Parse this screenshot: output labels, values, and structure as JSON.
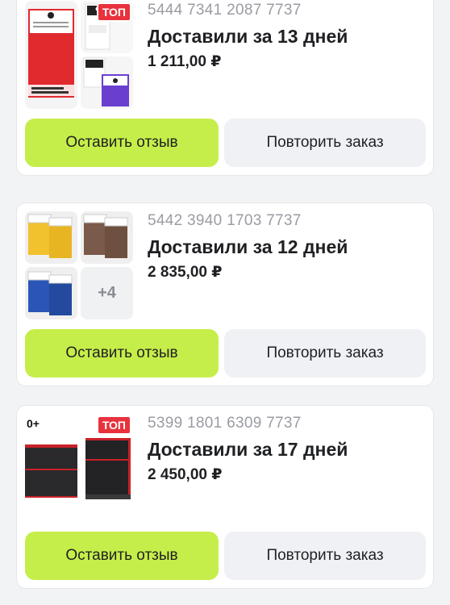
{
  "theme": {
    "accent": "#c6ee4a",
    "secondary_button": "#f0f1f4",
    "badge": "#e8323c",
    "background": "#f2f3f5"
  },
  "orders": [
    {
      "order_number": "5444 7341 2087 7737",
      "status": "Доставили за 13 дней",
      "price": "1 211,00 ₽",
      "badge": "ТОП",
      "thumbnails": [
        "red-card-sleeves",
        "white-card-sleeves",
        "purple-card-sleeves"
      ],
      "review_label": "Оставить отзыв",
      "repeat_label": "Повторить заказ"
    },
    {
      "order_number": "5442 3940 1703 7737",
      "status": "Доставили за 12 дней",
      "price": "2 835,00 ₽",
      "more_count": "+4",
      "thumbnails": [
        "yellow-card-sleeves",
        "brown-card-sleeves",
        "blue-card-sleeves"
      ],
      "review_label": "Оставить отзыв",
      "repeat_label": "Повторить заказ"
    },
    {
      "order_number": "5399 1801 6309 7737",
      "status": "Доставили за 17 дней",
      "price": "2 450,00 ₽",
      "badge": "ТОП",
      "thumbnail_label": "0+",
      "thumbnails": [
        "black-deck-box",
        "black-deck-box-open"
      ],
      "review_label": "Оставить отзыв",
      "repeat_label": "Повторить заказ"
    }
  ]
}
